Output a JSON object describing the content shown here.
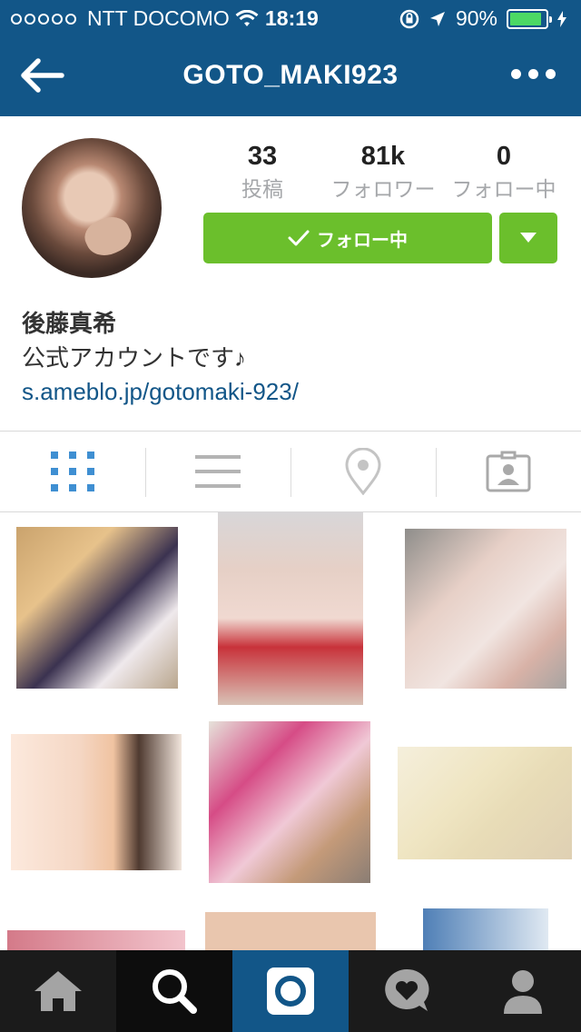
{
  "status_bar": {
    "carrier": "NTT DOCOMO",
    "time": "18:19",
    "battery_percent": "90%",
    "battery_level": 0.9
  },
  "nav": {
    "title": "GOTO_MAKI923"
  },
  "profile": {
    "stats": [
      {
        "value": "33",
        "label": "投稿"
      },
      {
        "value": "81k",
        "label": "フォロワー"
      },
      {
        "value": "0",
        "label": "フォロー中"
      }
    ],
    "follow_button_label": "フォロー中",
    "name": "後藤真希",
    "bio": "公式アカウントです♪",
    "link": "s.ameblo.jp/gotomaki-923/"
  },
  "tabs": [
    {
      "icon": "grid-icon",
      "active": true
    },
    {
      "icon": "list-icon",
      "active": false
    },
    {
      "icon": "location-icon",
      "active": false
    },
    {
      "icon": "tagged-icon",
      "active": false
    }
  ],
  "bottom_nav": [
    {
      "icon": "home-icon"
    },
    {
      "icon": "search-icon",
      "active": true
    },
    {
      "icon": "camera-icon"
    },
    {
      "icon": "activity-icon"
    },
    {
      "icon": "profile-icon"
    }
  ],
  "colors": {
    "header": "#125688",
    "follow_green": "#6bbf2c",
    "active_tab_blue": "#3f8fd2",
    "inactive_tab_gray": "#b4b4b4"
  }
}
